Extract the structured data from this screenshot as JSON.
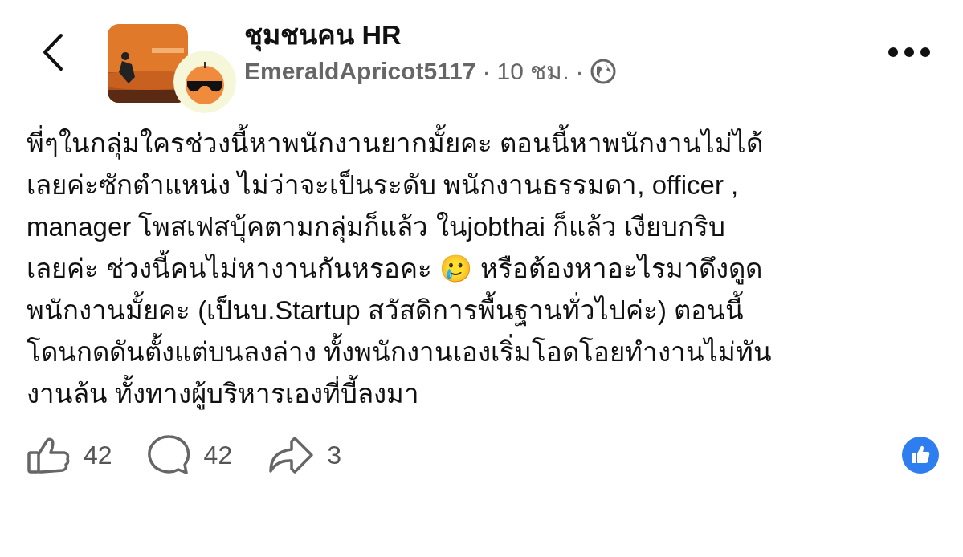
{
  "header": {
    "group_name": "ชุมชนคน HR",
    "author": "EmeraldApricot5117",
    "separator_1": "·",
    "time": "10 ชม.",
    "separator_2": "·"
  },
  "post": {
    "text": "พี่ๆในกลุ่มใครช่วงนี้หาพนักงานยากมั้ยคะ ตอนนี้หาพนักงานไม่ได้\nเลยค่ะซักตำแหน่ง ไม่ว่าจะเป็นระดับ พนักงานธรรมดา, officer ,\nmanager โพสเฟสบุ้คตามกลุ่มก็แล้ว ในjobthai ก็แล้ว เงียบกริบ\nเลยค่ะ ช่วงนี้คนไม่หางานกันหรอคะ 🥲 หรือต้องหาอะไรมาดึงดูด\nพนักงานมั้ยคะ (เป็นบ.Startup สวัสดิการพื้นฐานทั่วไปค่ะ) ตอนนี้\nโดนกดดันตั้งแต่บนลงล่าง ทั้งพนักงานเองเริ่มโอดโอยทำงานไม่ทัน\nงานล้น ทั้งทางผู้บริหารเองที่บี้ลงมา"
  },
  "actions": [
    {
      "kind": "like",
      "count": "42"
    },
    {
      "kind": "comment",
      "count": "42"
    },
    {
      "kind": "share",
      "count": "3"
    }
  ]
}
